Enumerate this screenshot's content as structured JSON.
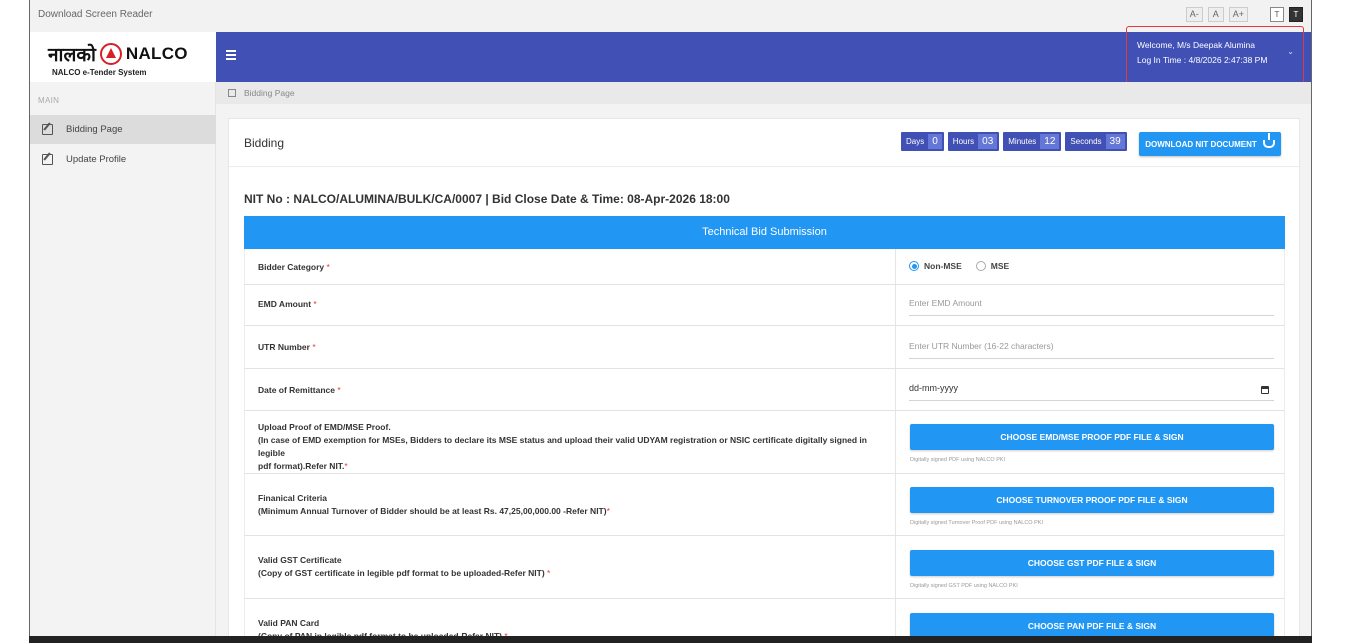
{
  "topbar": {
    "download_screen_reader": "Download Screen Reader",
    "font_small": "A-",
    "font_normal": "A",
    "font_large": "A+",
    "theme_light": "T",
    "theme_dark": "T"
  },
  "brand": {
    "hindi": "नालको",
    "name": "NALCO",
    "subtitle": "NALCO e-Tender System",
    "accent": "#d81e26"
  },
  "header": {
    "welcome": "Welcome, M/s Deepak Alumina",
    "login_time": "Log In Time : 4/8/2026 2:47:38 PM",
    "color": "#4050b5"
  },
  "sidebar": {
    "section": "MAIN",
    "items": [
      {
        "label": "Bidding Page",
        "active": true
      },
      {
        "label": "Update Profile",
        "active": false
      }
    ]
  },
  "breadcrumb": {
    "label": "Bidding Page"
  },
  "card": {
    "title": "Bidding",
    "timer": {
      "days_label": "Days",
      "days": "0",
      "hours_label": "Hours",
      "hours": "03",
      "minutes_label": "Minutes",
      "minutes": "12",
      "seconds_label": "Seconds",
      "seconds": "39"
    },
    "download_button": "DOWNLOAD NIT DOCUMENT",
    "nit_line": "NIT No : NALCO/ALUMINA/BULK/CA/0007 | Bid Close Date & Time: 08-Apr-2026 18:00",
    "section_title": "Technical Bid Submission"
  },
  "form": {
    "bidder_category": {
      "label": "Bidder Category",
      "req": "*",
      "options": [
        "Non-MSE",
        "MSE"
      ],
      "selected": "Non-MSE"
    },
    "emd_amount": {
      "label": "EMD Amount",
      "req": "*",
      "placeholder": "Enter EMD Amount"
    },
    "utr_number": {
      "label": "UTR Number",
      "req": "*",
      "placeholder": "Enter UTR Number (16-22 characters)"
    },
    "date_of_remittance": {
      "label": "Date of Remittance",
      "req": "*",
      "value": "dd-mm-yyyy"
    },
    "emd_proof": {
      "line1": "Upload Proof of EMD/MSE Proof.",
      "line2": "(In case of EMD exemption for MSEs, Bidders to declare its MSE status and upload their valid UDYAM registration or NSIC certificate digitally signed in legible",
      "line3": "pdf format).Refer NIT.",
      "req": "*",
      "button": "CHOOSE EMD/MSE PROOF PDF FILE & SIGN",
      "hint": "Digitally signed PDF using NALCO PKI"
    },
    "financial": {
      "line1": "Finanical Criteria",
      "line2": "(Minimum Annual Turnover of Bidder should be at least Rs. 47,25,00,000.00 -Refer NIT)",
      "req": "*",
      "button": "CHOOSE TURNOVER PROOF PDF FILE & SIGN",
      "hint": "Digitally signed Turnover Proof PDF using NALCO PKI"
    },
    "gst": {
      "line1": "Valid GST Certificate",
      "line2": "(Copy of GST certificate in legible pdf format to be uploaded-Refer NIT)",
      "req": "*",
      "button": "CHOOSE GST PDF FILE & SIGN",
      "hint": "Digitally signed GST PDF using NALCO PKI"
    },
    "pan": {
      "line1": "Valid PAN Card",
      "line2": "(Copy of PAN in legible pdf format to be uploaded-Refer NIT)",
      "req": "*",
      "button": "CHOOSE PAN PDF FILE & SIGN"
    }
  }
}
